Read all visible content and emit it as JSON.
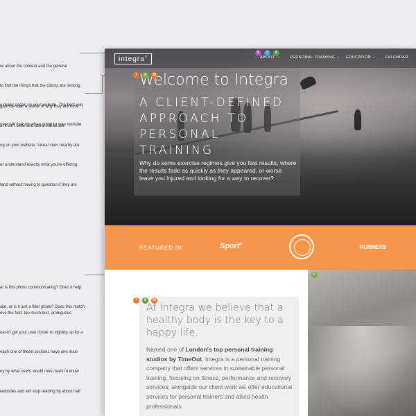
{
  "annotations": [
    {
      "lines": [
        "re about the content and the general",
        "to find the things that the clients are looking",
        "o many pages on your website. The best way",
        "user will look for when going to your website"
      ]
    },
    {
      "lines": [
        "give the user a sense of why they are here.",
        "ut it isn't clear and users will be left",
        "ng on your website. Visual cues nearby are",
        "er understand exactly what you're offering.",
        "tand without having to question if they are"
      ]
    },
    {
      "lines": [
        "at is this photo communicating? Does it help",
        "site, or is it just a filler photo? Does this match"
      ]
    },
    {
      "lines": [
        "ove the fold: too much text, ambiguous",
        "oesn't get your user closer to signing up for a",
        "each one of these sections have one main",
        "ny by what users would most want to know",
        "websites and will stop reading by about half"
      ]
    }
  ],
  "markers": [
    {
      "label": "6",
      "color": "#b44fc6"
    },
    {
      "label": "3",
      "color": "#3b9edb"
    },
    {
      "label": "6",
      "color": "#5aa144"
    },
    {
      "label": "7",
      "color": "#e0782a"
    },
    {
      "label": "9",
      "color": "#7cae3c"
    },
    {
      "label": "10",
      "color": "#e0782a"
    },
    {
      "label": "6",
      "color": "#7cae3c"
    },
    {
      "label": "7",
      "color": "#e0782a"
    },
    {
      "label": "8",
      "color": "#6a9e3a"
    },
    {
      "label": "10",
      "color": "#e0782a"
    }
  ],
  "site": {
    "logo": "integra",
    "nav": [
      "ABOUT",
      "PERSONAL TRAINING",
      "EDUCATION",
      "CALENDAR"
    ],
    "hero": {
      "title": "Welcome to Integra",
      "subtitle": "A CLIENT-DEFINED APPROACH TO PERSONAL TRAINING",
      "body": "Why do some exercise regimes give you fast results, where the results fade as quickly as they appeared, or worse leave you injured and looking for a way to recover?"
    },
    "featured": {
      "label": "FEATURED IN:",
      "brands": [
        "Sport",
        "RUNNERS"
      ],
      "color": "#f7954b"
    },
    "belief": "At Integra we believe that a healthy body is the key to a happy life.",
    "body": {
      "pre": "Named one of ",
      "strong": "London's top personal training studios by TimeOut",
      "post": ", Integra is a personal training company that offers services in sustainable personal training, focusing on fitness, performance and recovery services; alongside our client work we offer educational services for personal trainers and allied health professionals."
    }
  }
}
